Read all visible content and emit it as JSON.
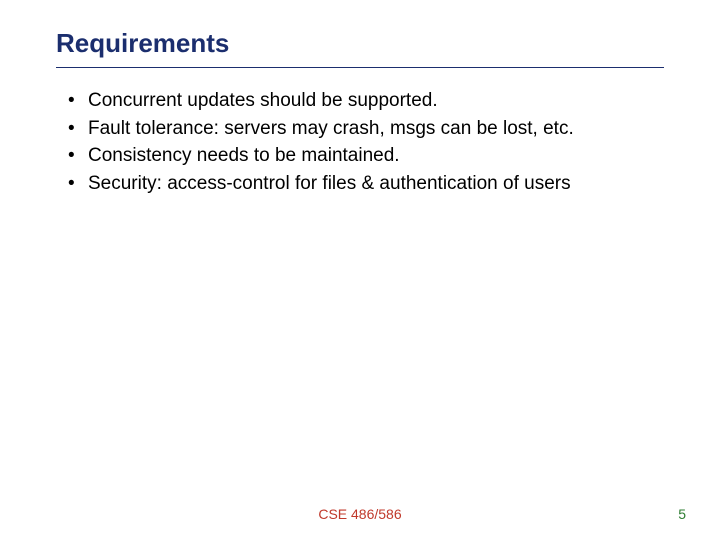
{
  "title": "Requirements",
  "bullets": [
    "Concurrent updates should be supported.",
    "Fault tolerance: servers may crash, msgs can be lost, etc.",
    "Consistency needs to be maintained.",
    "Security: access-control for files & authentication of users"
  ],
  "footer": {
    "center": "CSE 486/586",
    "page": "5"
  }
}
